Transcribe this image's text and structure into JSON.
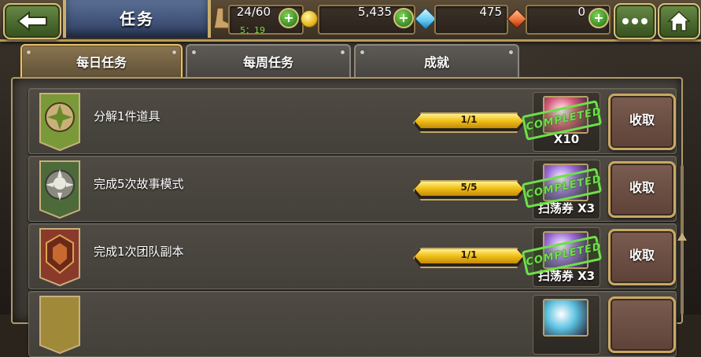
{
  "header": {
    "title": "任务",
    "stamina": "24/60",
    "stamina_timer": "5：19",
    "gold": "5,435",
    "diamonds": "475",
    "rubies": "0",
    "plus_label": "+"
  },
  "tabs": [
    {
      "label": "每日任务",
      "active": true
    },
    {
      "label": "每周任务",
      "active": false
    },
    {
      "label": "成就",
      "active": false
    }
  ],
  "tasks": [
    {
      "name": "分解1件道具",
      "progress": "1/1",
      "progress_fraction": 1.0,
      "reward_label": "X10",
      "stamp": "COMPLETED",
      "claim": "收取",
      "badge_color": "#7a9a3a",
      "reward_color": "#d85a7a"
    },
    {
      "name": "完成5次故事模式",
      "progress": "5/5",
      "progress_fraction": 1.0,
      "reward_label": "扫荡券 X3",
      "stamp": "COMPLETED",
      "claim": "收取",
      "badge_color": "#4c6a3a",
      "reward_color": "#9a6ad8"
    },
    {
      "name": "完成1次团队副本",
      "progress": "1/1",
      "progress_fraction": 1.0,
      "reward_label": "扫荡券 X3",
      "stamp": "COMPLETED",
      "claim": "收取",
      "badge_color": "#8a3a2a",
      "reward_color": "#9a6ad8"
    },
    {
      "name": "",
      "progress": "",
      "progress_fraction": 1.0,
      "reward_label": "",
      "stamp": "",
      "claim": "",
      "badge_color": "#a08a3a",
      "reward_color": "#5ac0e0"
    }
  ]
}
